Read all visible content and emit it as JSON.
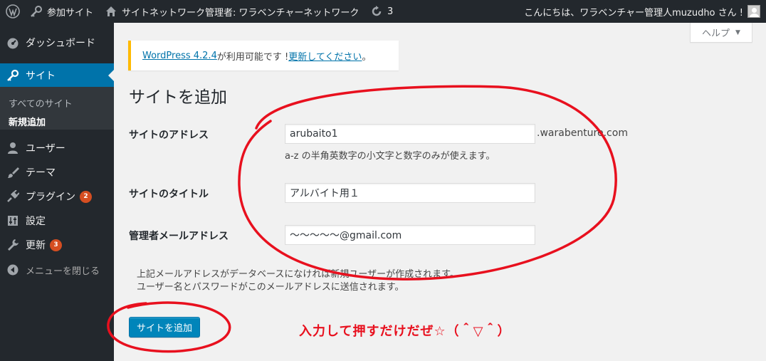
{
  "adminbar": {
    "my_sites": "参加サイト",
    "network_admin": "サイトネットワーク管理者: ワラベンチャーネットワーク",
    "updates_count": "3",
    "howdy": "こんにちは、ワラベンチャー管理人muzudho さん !"
  },
  "sidebar": {
    "dashboard": "ダッシュボード",
    "sites": "サイト",
    "submenu": {
      "all_sites": "すべてのサイト",
      "add_new": "新規追加"
    },
    "users": "ユーザー",
    "themes": "テーマ",
    "plugins": "プラグイン",
    "plugins_badge": "2",
    "settings": "設定",
    "updates": "更新",
    "updates_badge": "3",
    "collapse": "メニューを閉じる"
  },
  "help": {
    "label": "ヘルプ"
  },
  "notice": {
    "version_link": "WordPress 4.2.4",
    "text": " が利用可能です ! ",
    "update_link": "更新してください",
    "period": "。"
  },
  "page": {
    "title": "サイトを追加",
    "fields": {
      "address_label": "サイトのアドレス",
      "address_value": "arubaito1",
      "domain_suffix": ".warabenture.com",
      "address_desc": "a-z の半角英数字の小文字と数字のみが使えます。",
      "title_label": "サイトのタイトル",
      "title_value": "アルバイト用１",
      "email_label": "管理者メールアドレス",
      "email_value": "～～～～～@gmail.com"
    },
    "note_line1": "上記メールアドレスがデータベースになければ新規ユーザーが作成されます。",
    "note_line2": "ユーザー名とパスワードがこのメールアドレスに送信されます。",
    "submit_label": "サイトを追加"
  },
  "annotation": {
    "text": "入力して押すだけだぜ☆（＾▽＾）",
    "color": "#e8101e"
  },
  "colors": {
    "adminbar_bg": "#23282d",
    "sidebar_current": "#0073aa",
    "badge": "#d54e21",
    "button": "#0085ba",
    "notice_border": "#ffba00"
  }
}
